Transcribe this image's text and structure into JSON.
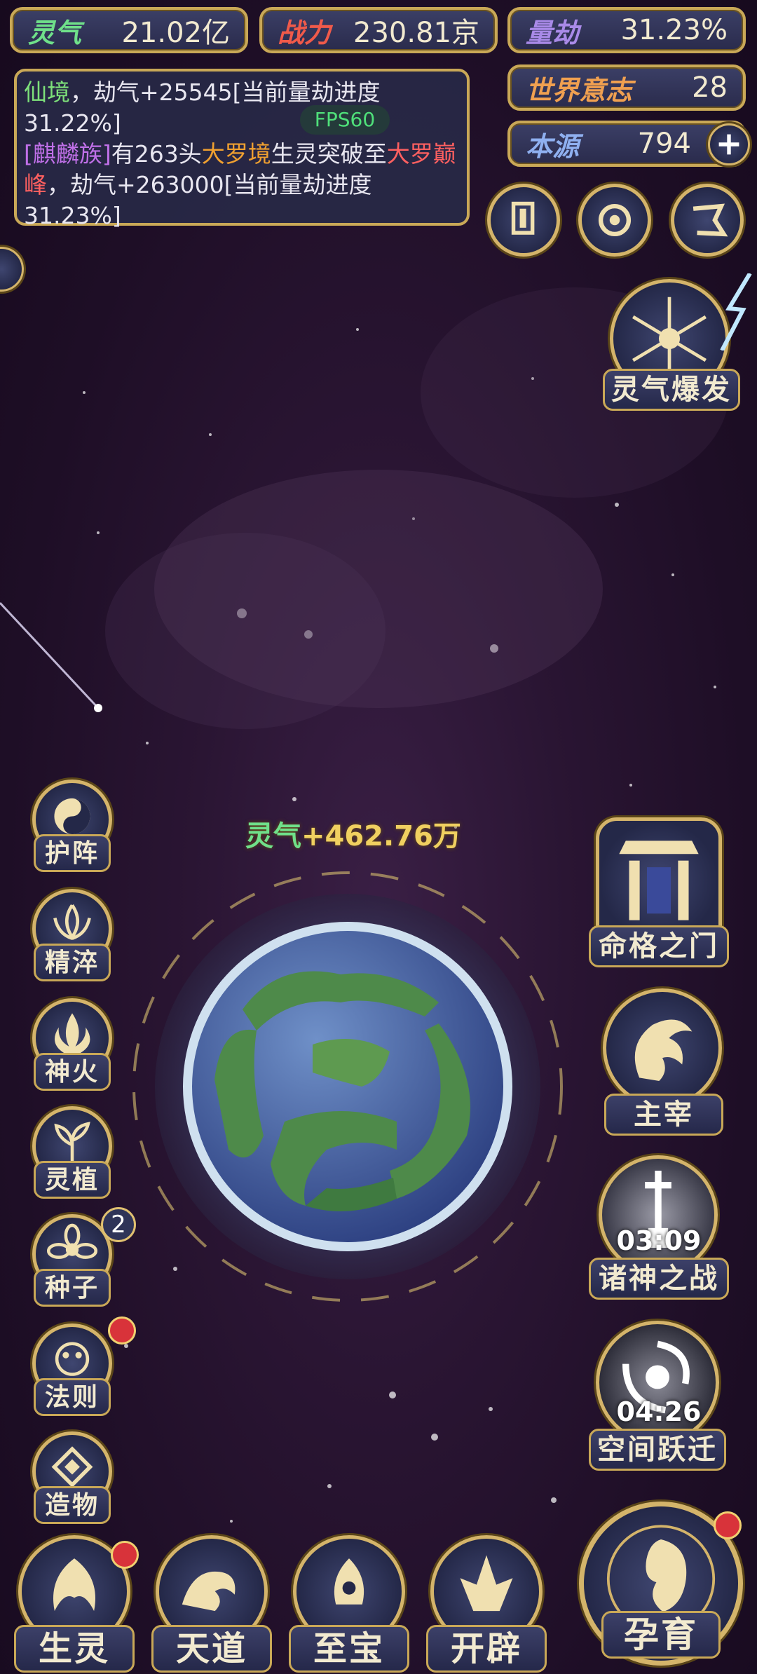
{
  "top_stats": {
    "lingqi": {
      "label": "灵气",
      "value": "21.02亿"
    },
    "zhanli": {
      "label": "战力",
      "value": "230.81京"
    },
    "liangjie": {
      "label": "量劫",
      "value": "31.23%"
    },
    "shijie": {
      "label": "世界意志",
      "value": "28"
    },
    "benyuan": {
      "label": "本源",
      "value": "794"
    }
  },
  "log": {
    "line1_realm": "仙境",
    "line1_text": "，劫气+25545[当前量劫进度31.22%]",
    "line2_race": "[麒麟族]",
    "line2_mid": "有263头",
    "line2_realm1": "大罗境",
    "line2_mid2": "生灵突破至",
    "line2_realm2": "大罗巅峰",
    "line2_end": "，劫气+263000[当前量劫进度31.23%]",
    "fps": "FPS60"
  },
  "burst": {
    "label": "灵气爆发"
  },
  "gain": {
    "label": "灵气",
    "value": "+462.76万"
  },
  "left_buttons": [
    {
      "label": "护阵"
    },
    {
      "label": "精淬"
    },
    {
      "label": "神火"
    },
    {
      "label": "灵植"
    },
    {
      "label": "种子",
      "badge": "2"
    },
    {
      "label": "法则"
    },
    {
      "label": "造物"
    }
  ],
  "right_buttons": {
    "mingge": {
      "label": "命格之门"
    },
    "zhuzai": {
      "label": "主宰"
    },
    "zhushen": {
      "label": "诸神之战",
      "timer": "03:09"
    },
    "kongjian": {
      "label": "空间跃迁",
      "timer": "04:26"
    }
  },
  "bottom_buttons": [
    {
      "label": "生灵"
    },
    {
      "label": "天道"
    },
    {
      "label": "至宝"
    },
    {
      "label": "开辟"
    }
  ],
  "yunyu": {
    "label": "孕育"
  },
  "colors": {
    "gold": "#c9a857",
    "green_realm": "#7de07a",
    "purple_race": "#c070e8",
    "orange_realm": "#f0a030",
    "red_realm": "#ff6060"
  }
}
